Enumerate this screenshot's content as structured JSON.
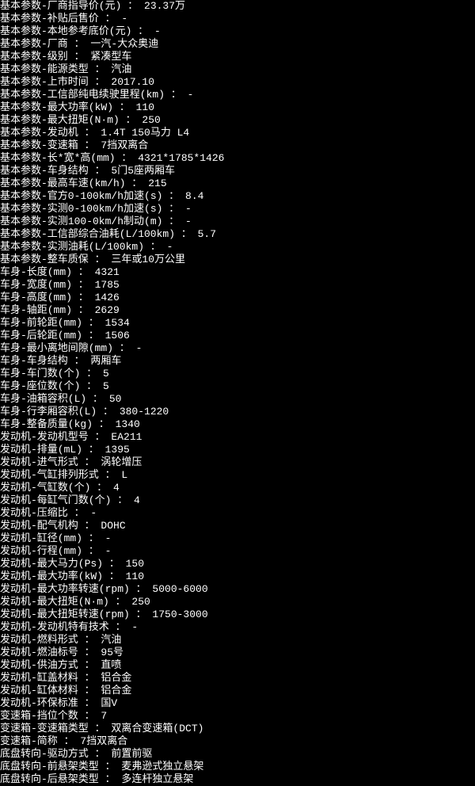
{
  "specs": [
    {
      "label": "基本参数-厂商指导价(元)",
      "value": "23.37万"
    },
    {
      "label": "基本参数-补贴后售价",
      "value": "-"
    },
    {
      "label": "基本参数-本地参考底价(元)",
      "value": "-"
    },
    {
      "label": "基本参数-厂商",
      "value": "一汽-大众奥迪"
    },
    {
      "label": "基本参数-级别",
      "value": "紧凑型车"
    },
    {
      "label": "基本参数-能源类型",
      "value": "汽油"
    },
    {
      "label": "基本参数-上市时间",
      "value": "2017.10"
    },
    {
      "label": "基本参数-工信部纯电续驶里程(km)",
      "value": "-"
    },
    {
      "label": "基本参数-最大功率(kW)",
      "value": "110"
    },
    {
      "label": "基本参数-最大扭矩(N·m)",
      "value": "250"
    },
    {
      "label": "基本参数-发动机",
      "value": "1.4T 150马力 L4"
    },
    {
      "label": "基本参数-变速箱",
      "value": "7挡双离合"
    },
    {
      "label": "基本参数-长*宽*高(mm)",
      "value": "4321*1785*1426"
    },
    {
      "label": "基本参数-车身结构",
      "value": "5门5座两厢车"
    },
    {
      "label": "基本参数-最高车速(km/h)",
      "value": "215"
    },
    {
      "label": "基本参数-官方0-100km/h加速(s)",
      "value": "8.4"
    },
    {
      "label": "基本参数-实测0-100km/h加速(s)",
      "value": "-"
    },
    {
      "label": "基本参数-实测100-0km/h制动(m)",
      "value": "-"
    },
    {
      "label": "基本参数-工信部综合油耗(L/100km)",
      "value": "5.7"
    },
    {
      "label": "基本参数-实测油耗(L/100km)",
      "value": "-"
    },
    {
      "label": "基本参数-整车质保",
      "value": "三年或10万公里"
    },
    {
      "label": "车身-长度(mm)",
      "value": "4321"
    },
    {
      "label": "车身-宽度(mm)",
      "value": "1785"
    },
    {
      "label": "车身-高度(mm)",
      "value": "1426"
    },
    {
      "label": "车身-轴距(mm)",
      "value": "2629"
    },
    {
      "label": "车身-前轮距(mm)",
      "value": "1534"
    },
    {
      "label": "车身-后轮距(mm)",
      "value": "1506"
    },
    {
      "label": "车身-最小离地间隙(mm)",
      "value": "-"
    },
    {
      "label": "车身-车身结构",
      "value": "两厢车"
    },
    {
      "label": "车身-车门数(个)",
      "value": "5"
    },
    {
      "label": "车身-座位数(个)",
      "value": "5"
    },
    {
      "label": "车身-油箱容积(L)",
      "value": "50"
    },
    {
      "label": "车身-行李厢容积(L)",
      "value": "380-1220"
    },
    {
      "label": "车身-整备质量(kg)",
      "value": "1340"
    },
    {
      "label": "发动机-发动机型号",
      "value": "EA211"
    },
    {
      "label": "发动机-排量(mL)",
      "value": "1395"
    },
    {
      "label": "发动机-进气形式",
      "value": "涡轮增压"
    },
    {
      "label": "发动机-气缸排列形式",
      "value": "L"
    },
    {
      "label": "发动机-气缸数(个)",
      "value": "4"
    },
    {
      "label": "发动机-每缸气门数(个)",
      "value": "4"
    },
    {
      "label": "发动机-压缩比",
      "value": "-"
    },
    {
      "label": "发动机-配气机构",
      "value": "DOHC"
    },
    {
      "label": "发动机-缸径(mm)",
      "value": "-"
    },
    {
      "label": "发动机-行程(mm)",
      "value": "-"
    },
    {
      "label": "发动机-最大马力(Ps)",
      "value": "150"
    },
    {
      "label": "发动机-最大功率(kW)",
      "value": "110"
    },
    {
      "label": "发动机-最大功率转速(rpm)",
      "value": "5000-6000"
    },
    {
      "label": "发动机-最大扭矩(N·m)",
      "value": "250"
    },
    {
      "label": "发动机-最大扭矩转速(rpm)",
      "value": "1750-3000"
    },
    {
      "label": "发动机-发动机特有技术",
      "value": "-"
    },
    {
      "label": "发动机-燃料形式",
      "value": "汽油"
    },
    {
      "label": "发动机-燃油标号",
      "value": "95号"
    },
    {
      "label": "发动机-供油方式",
      "value": "直喷"
    },
    {
      "label": "发动机-缸盖材料",
      "value": "铝合金"
    },
    {
      "label": "发动机-缸体材料",
      "value": "铝合金"
    },
    {
      "label": "发动机-环保标准",
      "value": "国V"
    },
    {
      "label": "变速箱-挡位个数",
      "value": "7"
    },
    {
      "label": "变速箱-变速箱类型",
      "value": "双离合变速箱(DCT)"
    },
    {
      "label": "变速箱-简称",
      "value": "7挡双离合"
    },
    {
      "label": "底盘转向-驱动方式",
      "value": "前置前驱"
    },
    {
      "label": "底盘转向-前悬架类型",
      "value": "麦弗逊式独立悬架"
    },
    {
      "label": "底盘转向-后悬架类型",
      "value": "多连杆独立悬架"
    }
  ]
}
